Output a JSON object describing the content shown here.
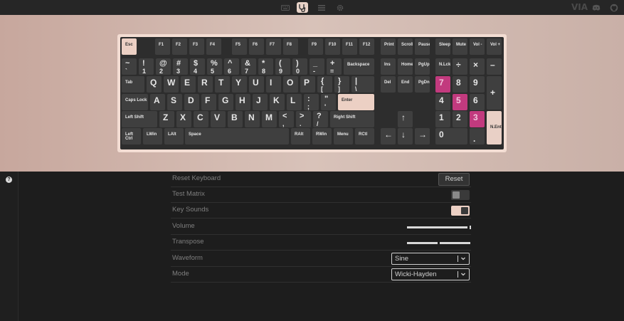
{
  "topbar": {
    "icons": [
      "keyboard-icon",
      "stethoscope-icon",
      "sliders-icon",
      "gear-icon"
    ],
    "right_text": "VIA"
  },
  "keyboard": {
    "fn_row": [
      "Esc",
      "F1",
      "F2",
      "F3",
      "F4",
      "F5",
      "F6",
      "F7",
      "F8",
      "F9",
      "F10",
      "F11",
      "F12",
      "Print",
      "Scroll",
      "Pause",
      "Sleep",
      "Mute",
      "Vol -",
      "Vol +"
    ],
    "num_row_top": [
      "~",
      "!",
      "@",
      "#",
      "$",
      "%",
      "^",
      "&",
      "*",
      "(",
      ")",
      "_",
      "+"
    ],
    "num_row_bottom": [
      "`",
      "1",
      "2",
      "3",
      "4",
      "5",
      "6",
      "7",
      "8",
      "9",
      "0",
      "-",
      "="
    ],
    "backspace": "Backspace",
    "nav1": [
      "Ins",
      "Home",
      "PgUp"
    ],
    "numpad_top": [
      "N.Lck",
      "÷",
      "×",
      "–"
    ],
    "tab": "Tab",
    "qrow": [
      "Q",
      "W",
      "E",
      "R",
      "T",
      "Y",
      "U",
      "I",
      "O",
      "P"
    ],
    "qrow_sym": [
      [
        "{",
        "["
      ],
      [
        "}",
        "]"
      ],
      [
        "|",
        "\\"
      ]
    ],
    "nav2": [
      "Del",
      "End",
      "PgDn"
    ],
    "np_row2": [
      "7",
      "8",
      "9",
      "+"
    ],
    "caps": "Caps Lock",
    "arow": [
      "A",
      "S",
      "D",
      "F",
      "G",
      "H",
      "J",
      "K",
      "L"
    ],
    "arow_sym": [
      [
        ":",
        ";"
      ],
      [
        "\"",
        "'"
      ]
    ],
    "enter": "Enter",
    "np_row3": [
      "4",
      "5",
      "6"
    ],
    "lshift": "Left Shift",
    "zrow": [
      "Z",
      "X",
      "C",
      "V",
      "B",
      "N",
      "M"
    ],
    "zrow_sym": [
      [
        "<",
        ","
      ],
      [
        ">",
        "."
      ],
      [
        "?",
        "/"
      ]
    ],
    "rshift": "Right Shift",
    "up": "↑",
    "np_row4": [
      "1",
      "2",
      "3"
    ],
    "nent": "N.Ent",
    "bottom_row": [
      "Left Ctrl",
      "LWin",
      "LAlt",
      "Space",
      "RAlt",
      "RWin",
      "Menu",
      "RCtl"
    ],
    "arrows": [
      "←",
      "↓",
      "→"
    ],
    "np_row5": [
      "0",
      "."
    ]
  },
  "settings": {
    "reset_label": "Reset Keyboard",
    "reset_button": "Reset",
    "test_matrix": "Test Matrix",
    "key_sounds": "Key Sounds",
    "volume": "Volume",
    "volume_level": 0.97,
    "transpose": "Transpose",
    "waveform": "Waveform",
    "waveform_value": "Sine",
    "mode": "Mode",
    "mode_value": "Wicki-Hayden"
  }
}
